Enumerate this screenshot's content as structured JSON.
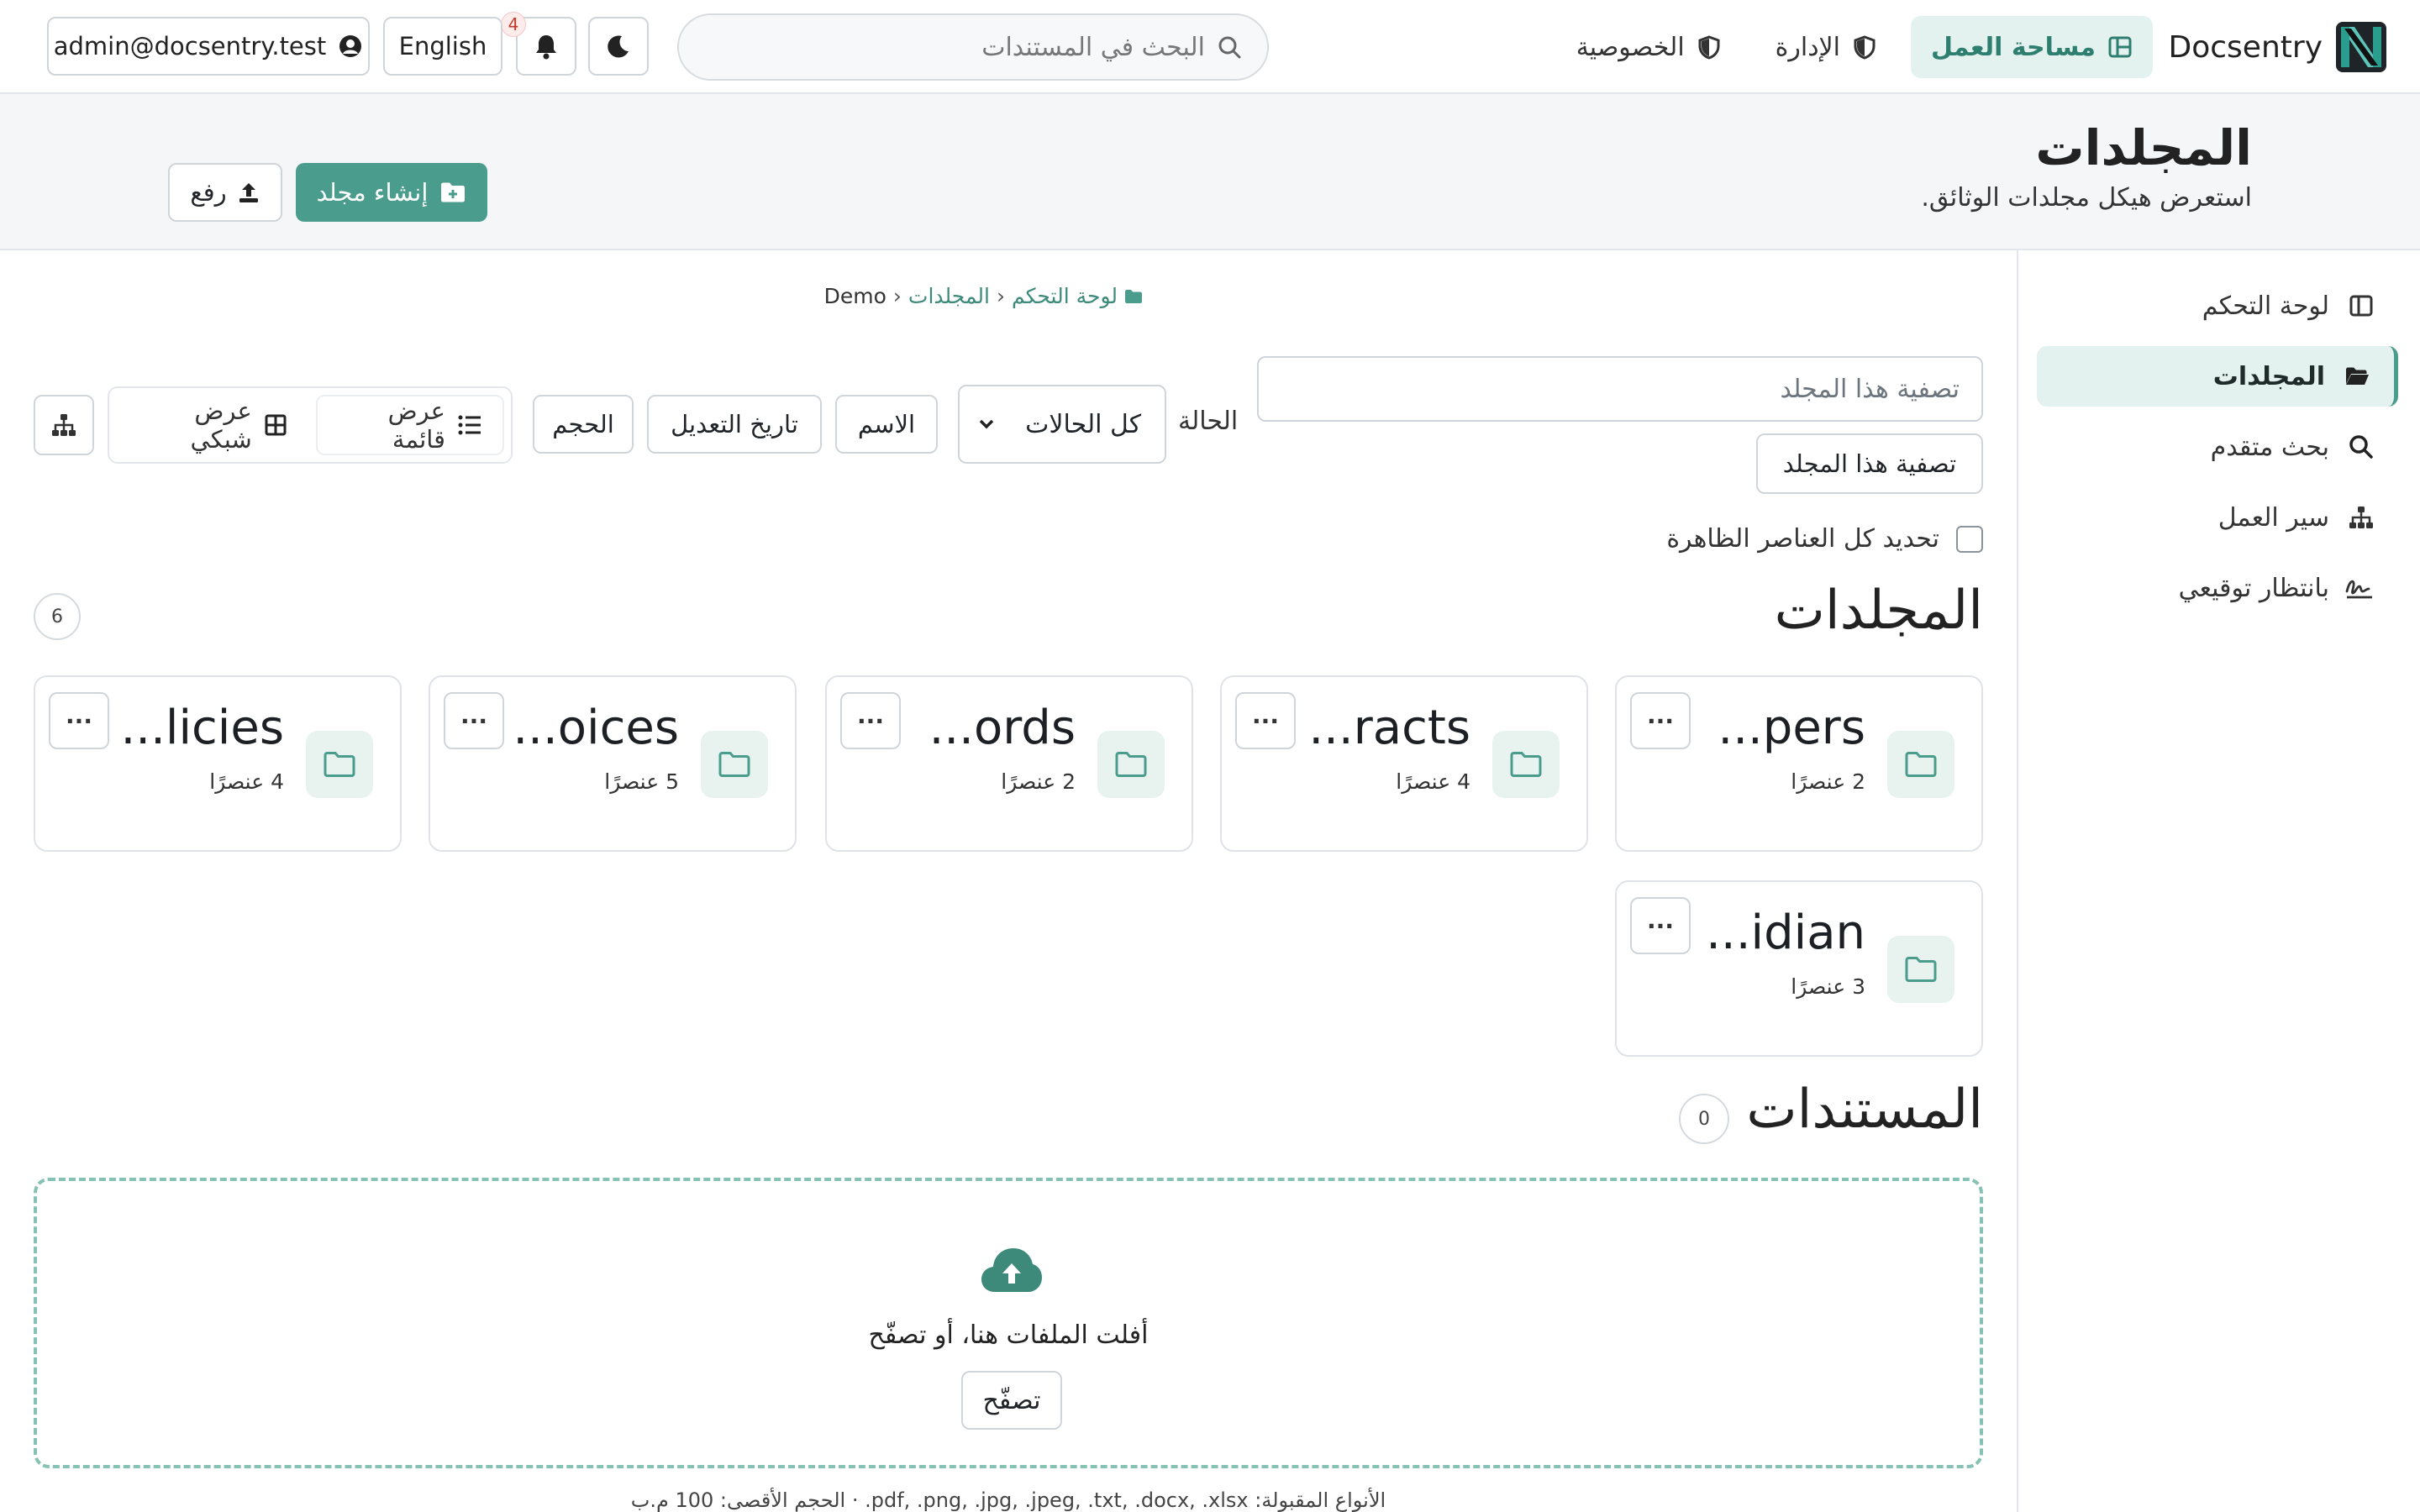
{
  "brand": {
    "name": "Docsentry"
  },
  "nav": {
    "links": [
      {
        "label": "مساحة العمل",
        "icon": "layout-icon",
        "active": true
      },
      {
        "label": "الإدارة",
        "icon": "shield-icon",
        "active": false
      },
      {
        "label": "الخصوصية",
        "icon": "shield-icon",
        "active": false
      }
    ],
    "search_placeholder": "البحث في المستندات",
    "notifications_count": "4",
    "language_label": "English",
    "user_email": "admin@docsentry.test"
  },
  "header": {
    "title": "المجلدات",
    "subtitle": "استعرض هيكل مجلدات الوثائق.",
    "create_folder_label": "إنشاء مجلد",
    "upload_label": "رفع"
  },
  "sidebar": {
    "items": [
      {
        "label": "لوحة التحكم",
        "icon": "layout-icon",
        "active": false
      },
      {
        "label": "المجلدات",
        "icon": "folder-open-icon",
        "active": true
      },
      {
        "label": "بحث متقدم",
        "icon": "search-icon",
        "active": false
      },
      {
        "label": "سير العمل",
        "icon": "sitemap-icon",
        "active": false
      },
      {
        "label": "بانتظار توقيعي",
        "icon": "signature-icon",
        "active": false
      }
    ]
  },
  "breadcrumb": {
    "items": [
      "لوحة التحكم",
      "المجلدات"
    ],
    "current": "Demo"
  },
  "filters": {
    "filter_placeholder": "تصفية هذا المجلد",
    "filter_button": "تصفية هذا المجلد",
    "status_label": "الحالة",
    "status_value": "كل الحالات",
    "sort_name": "الاسم",
    "sort_date": "تاريخ التعديل",
    "sort_size": "الحجم",
    "view_list": "عرض قائمة",
    "view_grid": "عرض شبكي",
    "select_all": "تحديد كل العناصر الظاهرة"
  },
  "folders": {
    "title": "المجلدات",
    "count": "6",
    "items": [
      {
        "name": "...pers",
        "count": "2 عنصرًا"
      },
      {
        "name": "...racts",
        "count": "4 عنصرًا"
      },
      {
        "name": "...ords",
        "count": "2 عنصرًا"
      },
      {
        "name": "...oices",
        "count": "5 عنصرًا"
      },
      {
        "name": "...licies",
        "count": "4 عنصرًا"
      },
      {
        "name": "...idian",
        "count": "3 عنصرًا"
      }
    ],
    "menu_label": "···"
  },
  "documents": {
    "title": "المستندات",
    "count": "0",
    "drop_text": "أفلت الملفات هنا، أو تصفّح",
    "browse_label": "تصفّح",
    "accepted_text": "الأنواع المقبولة: pdf, .png, .jpg, .jpeg, .txt, .docx, .xlsx. · الحجم الأقصى: 100 م.ب"
  },
  "colors": {
    "accent": "#4a9c8c",
    "accent_light": "#e4f2ef",
    "badge": "#c0392b"
  }
}
